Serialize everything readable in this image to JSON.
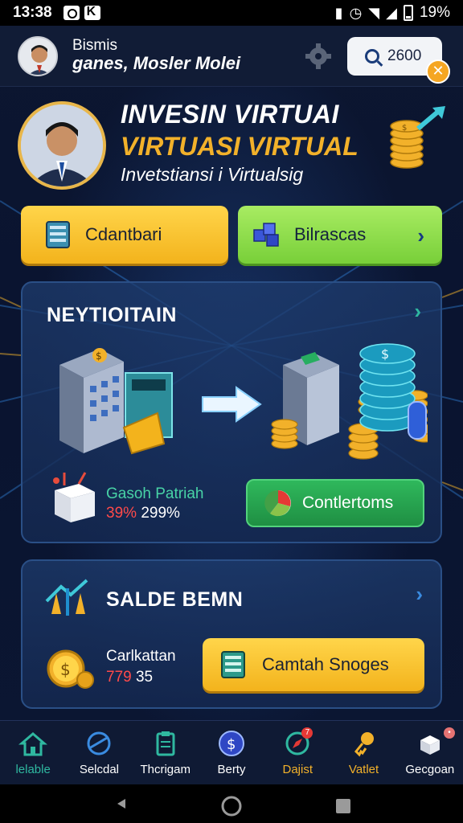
{
  "status_bar": {
    "time": "13:38",
    "battery": "19%"
  },
  "header": {
    "greeting": "Bismis",
    "name": "ganes, Mosler  Molei",
    "coin_value": "2600",
    "icons": [
      "avatar",
      "gear-icon",
      "search-icon",
      "coin-badge-icon"
    ]
  },
  "hero": {
    "title_line1": "INVESIN VIRTUAI",
    "title_line2": "VIRTUASI VIRTUAL",
    "subtitle": "Invetstiansi i Virtualsig"
  },
  "actions": {
    "left_label": "Cdantbari",
    "right_label": "Bilrascas"
  },
  "card_invest": {
    "title": "NEYTIOITAIN",
    "stat_label": "Gasoh Patriah",
    "stat_red": "39%",
    "stat_white": "299%",
    "button_label": "Contlertoms"
  },
  "card_balance": {
    "title": "SALDE BEMN",
    "stat_label": "Carlkattan",
    "stat_red": "779",
    "stat_white": "35",
    "button_label": "Camtah Snoges"
  },
  "bottom_nav": [
    {
      "label": "lelable",
      "icon": "home-icon",
      "color": "#2fb8a0"
    },
    {
      "label": "Selcdal",
      "icon": "globe-icon",
      "color": "#3a8be0"
    },
    {
      "label": "Thcrigam",
      "icon": "clipboard-icon",
      "color": "#2fb8a0"
    },
    {
      "label": "Berty",
      "icon": "dollar-coin-icon",
      "color": "#3a6fe0"
    },
    {
      "label": "Dajist",
      "icon": "compass-icon",
      "color": "#2fb8a0"
    },
    {
      "label": "Vatlet",
      "icon": "key-icon",
      "color": "#f2b12a"
    },
    {
      "label": "Gecgoan",
      "icon": "box-icon",
      "color": "#e0e0e0"
    }
  ],
  "colors": {
    "accent_gold": "#f2b12a",
    "accent_green": "#78cf39",
    "stat_teal": "#48d3a6",
    "stat_red": "#ff4a4a"
  }
}
